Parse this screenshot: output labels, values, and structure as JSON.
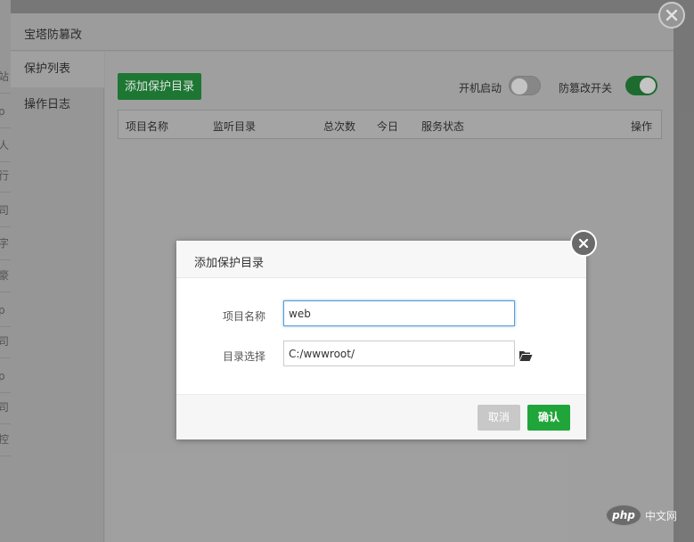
{
  "background_fragments": [
    "站",
    "p",
    "人",
    "行",
    "司",
    "字",
    "豪",
    "p",
    "司",
    "p",
    "司",
    "控"
  ],
  "panel": {
    "title": "宝塔防篡改",
    "close_icon": "close-icon",
    "sidebar": [
      {
        "label": "保护列表",
        "active": true
      },
      {
        "label": "操作日志",
        "active": false
      }
    ],
    "add_button": "添加保护目录",
    "switches": [
      {
        "label": "开机启动",
        "state": "off"
      },
      {
        "label": "防篡改开关",
        "state": "on"
      }
    ],
    "table_headers": [
      "项目名称",
      "监听目录",
      "总次数",
      "今日",
      "服务状态",
      "操作"
    ]
  },
  "modal": {
    "title": "添加保护目录",
    "fields": [
      {
        "label": "项目名称",
        "value": "web"
      },
      {
        "label": "目录选择",
        "value": "C:/wwwroot/"
      }
    ],
    "folder_icon": "folder-open-icon",
    "cancel_label": "取消",
    "ok_label": "确认"
  },
  "watermark": {
    "logo": "php",
    "text": "中文网"
  },
  "colors": {
    "accent_green": "#20a53a",
    "switch_on": "#1e6e30",
    "focus_blue": "#5b9bd5"
  }
}
